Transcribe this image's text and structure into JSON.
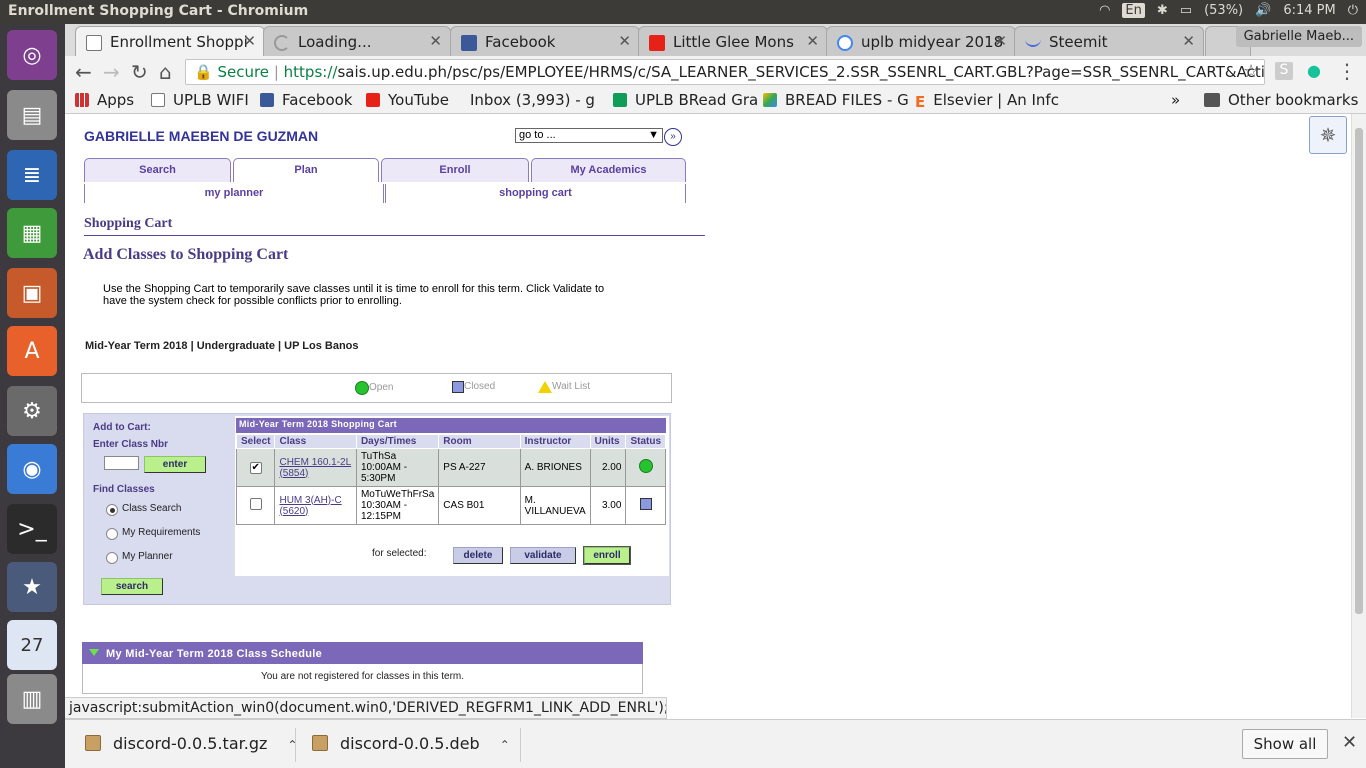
{
  "system": {
    "window_title": "Enrollment Shopping Cart - Chromium",
    "lang": "En",
    "battery": "(53%)",
    "time": "6:14 PM"
  },
  "tabs": [
    {
      "label": "Enrollment Shoppi",
      "icon": "page-icon"
    },
    {
      "label": "Loading...",
      "icon": "loading-icon"
    },
    {
      "label": "Facebook",
      "icon": "facebook-icon"
    },
    {
      "label": "Little Glee Mons",
      "icon": "youtube-icon"
    },
    {
      "label": "uplb midyear 2018",
      "icon": "google-icon"
    },
    {
      "label": "Steemit",
      "icon": "steemit-icon"
    }
  ],
  "profile_name": "Gabrielle Maeb...",
  "address": {
    "secure_label": "Secure",
    "scheme": "https://",
    "url": "sais.up.edu.ph/psc/ps/EMPLOYEE/HRMS/c/SA_LEARNER_SERVICES_2.SSR_SSENRL_CART.GBL?Page=SSR_SSENRL_CART&Action=A&ACAD_CAR..."
  },
  "bookmarks": {
    "apps": "Apps",
    "items": [
      "UPLB WIFI",
      "Facebook",
      "YouTube",
      "Inbox (3,993) - g",
      "UPLB BRead Gra",
      "BREAD FILES - G",
      "Elsevier | An Infc"
    ],
    "more": "»",
    "other": "Other bookmarks"
  },
  "header": {
    "student_name": "GABRIELLE MAEBEN DE GUZMAN",
    "goto_value": "go to ..."
  },
  "main_tabs": [
    "Search",
    "Plan",
    "Enroll",
    "My Academics"
  ],
  "sub_tabs": [
    "my planner",
    "shopping cart"
  ],
  "section_title": "Shopping Cart",
  "page_heading": "Add Classes to Shopping Cart",
  "intro_text": "Use the Shopping Cart to temporarily save classes until it is time to enroll for this term.  Click Validate to have the system check for possible conflicts prior to enrolling.",
  "term_line": "Mid-Year Term 2018 | Undergraduate | UP Los Banos",
  "legend": {
    "open": "Open",
    "closed": "Closed",
    "wait": "Wait List"
  },
  "add_panel": {
    "add_to_cart": "Add to Cart:",
    "enter_class_nbr": "Enter Class Nbr",
    "enter_btn": "enter",
    "find_classes": "Find Classes",
    "options": [
      "Class Search",
      "My Requirements",
      "My Planner"
    ],
    "search_btn": "search"
  },
  "cart": {
    "title": "Mid-Year Term 2018 Shopping Cart",
    "columns": [
      "Select",
      "Class",
      "Days/Times",
      "Room",
      "Instructor",
      "Units",
      "Status"
    ],
    "rows": [
      {
        "class_code": "CHEM 160.1-2L",
        "class_nbr": "(5854)",
        "days": "TuThSa",
        "times": "10:00AM -",
        "times2": "5:30PM",
        "room": "PS A-227",
        "instructor": "A. BRIONES",
        "units": "2.00",
        "status": "open",
        "selected": true
      },
      {
        "class_code": "HUM 3(AH)-C",
        "class_nbr": "(5620)",
        "days": "MoTuWeThFrSa",
        "times": "10:30AM -",
        "times2": "12:15PM",
        "room": "CAS B01",
        "instructor": "M.",
        "instructor2": "VILLANUEVA",
        "units": "3.00",
        "status": "closed",
        "selected": false
      }
    ],
    "for_selected": "for selected:",
    "delete_btn": "delete",
    "validate_btn": "validate",
    "enroll_btn": "enroll"
  },
  "schedule": {
    "title": "My Mid-Year Term 2018 Class Schedule",
    "message": "You are not registered for classes in this term."
  },
  "status_bar": "javascript:submitAction_win0(document.win0,'DERIVED_REGFRM1_LINK_ADD_ENRL');",
  "downloads": {
    "items": [
      "discord-0.0.5.tar.gz",
      "discord-0.0.5.deb"
    ],
    "show_all": "Show all"
  }
}
